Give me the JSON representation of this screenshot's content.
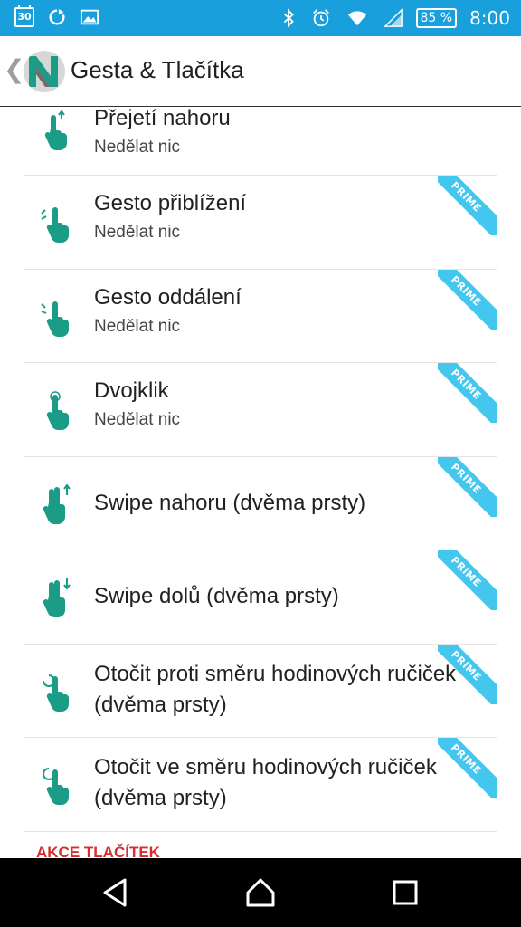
{
  "status_bar": {
    "calendar_day": "30",
    "battery": "85 %",
    "time": "8:00",
    "icons": [
      "calendar-icon",
      "sync-icon",
      "image-icon",
      "bluetooth-icon",
      "alarm-icon",
      "wifi-icon",
      "signal-icon",
      "battery-icon"
    ]
  },
  "header": {
    "back_glyph": "❮",
    "title": "Gesta & Tlačítka",
    "logo_letter": "N"
  },
  "items": [
    {
      "title": "Přejetí nahoru",
      "subtitle": "Nedělat nic",
      "prime": false,
      "icon": "swipe-up-hand-icon"
    },
    {
      "title": "Gesto přiblížení",
      "subtitle": "Nedělat nic",
      "prime": true,
      "icon": "pinch-in-hand-icon"
    },
    {
      "title": "Gesto oddálení",
      "subtitle": "Nedělat nic",
      "prime": true,
      "icon": "pinch-out-hand-icon"
    },
    {
      "title": "Dvojklik",
      "subtitle": "Nedělat nic",
      "prime": true,
      "icon": "double-tap-hand-icon"
    },
    {
      "title": "Swipe nahoru (dvěma prsty)",
      "subtitle": "",
      "prime": true,
      "icon": "two-finger-swipe-up-icon"
    },
    {
      "title": "Swipe dolů (dvěma prsty)",
      "subtitle": "",
      "prime": true,
      "icon": "two-finger-swipe-down-icon"
    },
    {
      "title": "Otočit proti směru hodinových ručiček (dvěma prsty)",
      "subtitle": "",
      "prime": true,
      "icon": "rotate-ccw-hand-icon"
    },
    {
      "title": "Otočit ve směru hodinových ručiček (dvěma prsty)",
      "subtitle": "",
      "prime": true,
      "icon": "rotate-cw-hand-icon"
    }
  ],
  "prime_label": "PRIME",
  "section_heading": "AKCE TLAČÍTEK",
  "colors": {
    "status_bar": "#1a9fdd",
    "icon_teal": "#1a9c86",
    "prime_ribbon": "#43c7ef",
    "section_red": "#d32f2f"
  }
}
